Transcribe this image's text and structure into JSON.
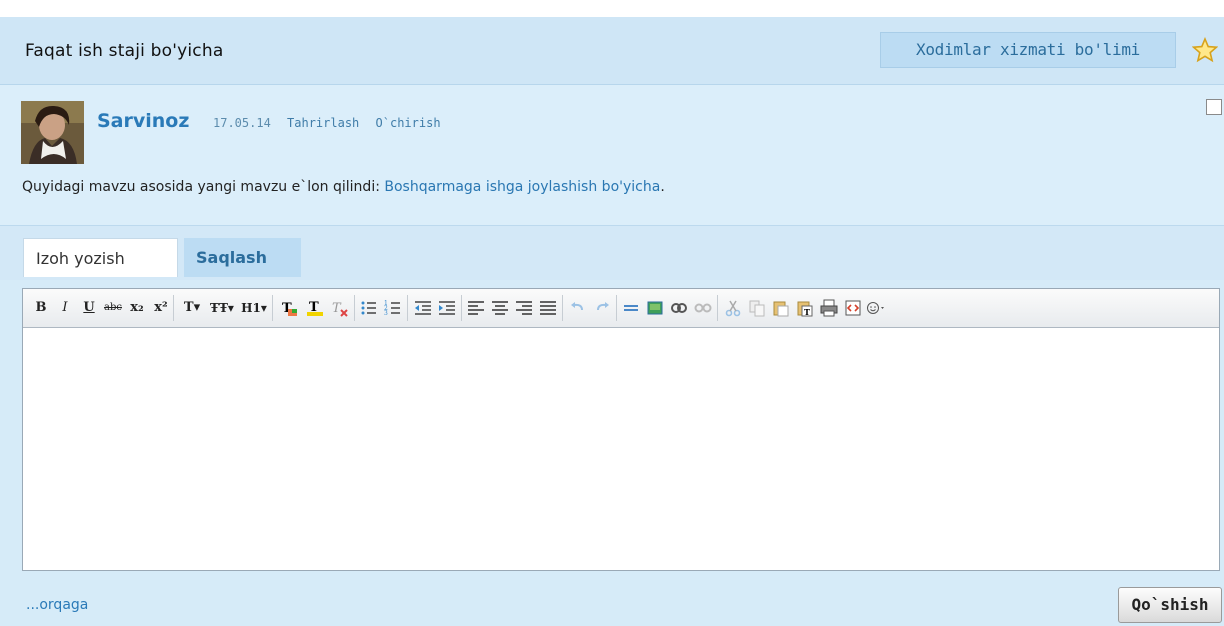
{
  "header": {
    "title": "Faqat ish staji bo'yicha",
    "department_button": "Xodimlar xizmati bo'limi",
    "star_icon": "star-icon"
  },
  "post": {
    "author": "Sarvinoz",
    "date": "17.05.14",
    "edit_link": "Tahrirlash",
    "delete_link": "O`chirish",
    "text_prefix": "Quyidagi mavzu asosida yangi mavzu e`lon qilindi: ",
    "topic_link": "Boshqarmaga ishga joylashish bo'yicha",
    "text_suffix": "."
  },
  "tabs": {
    "write": "Izoh yozish",
    "save": "Saqlash"
  },
  "toolbar": {
    "bold": "B",
    "italic": "I",
    "underline": "U",
    "strike": "abc",
    "subscript": "x₂",
    "superscript": "x²",
    "font_size": "T▾",
    "font_family": "ŦŦ▾",
    "heading": "H1▾"
  },
  "footer": {
    "back_link": "...orqaga",
    "add_button": "Qo`shish"
  },
  "colors": {
    "background": "#d6ebf8",
    "link": "#2a7ab8",
    "tab_active": "#ffffff",
    "button_light": "#bcdcf3"
  }
}
